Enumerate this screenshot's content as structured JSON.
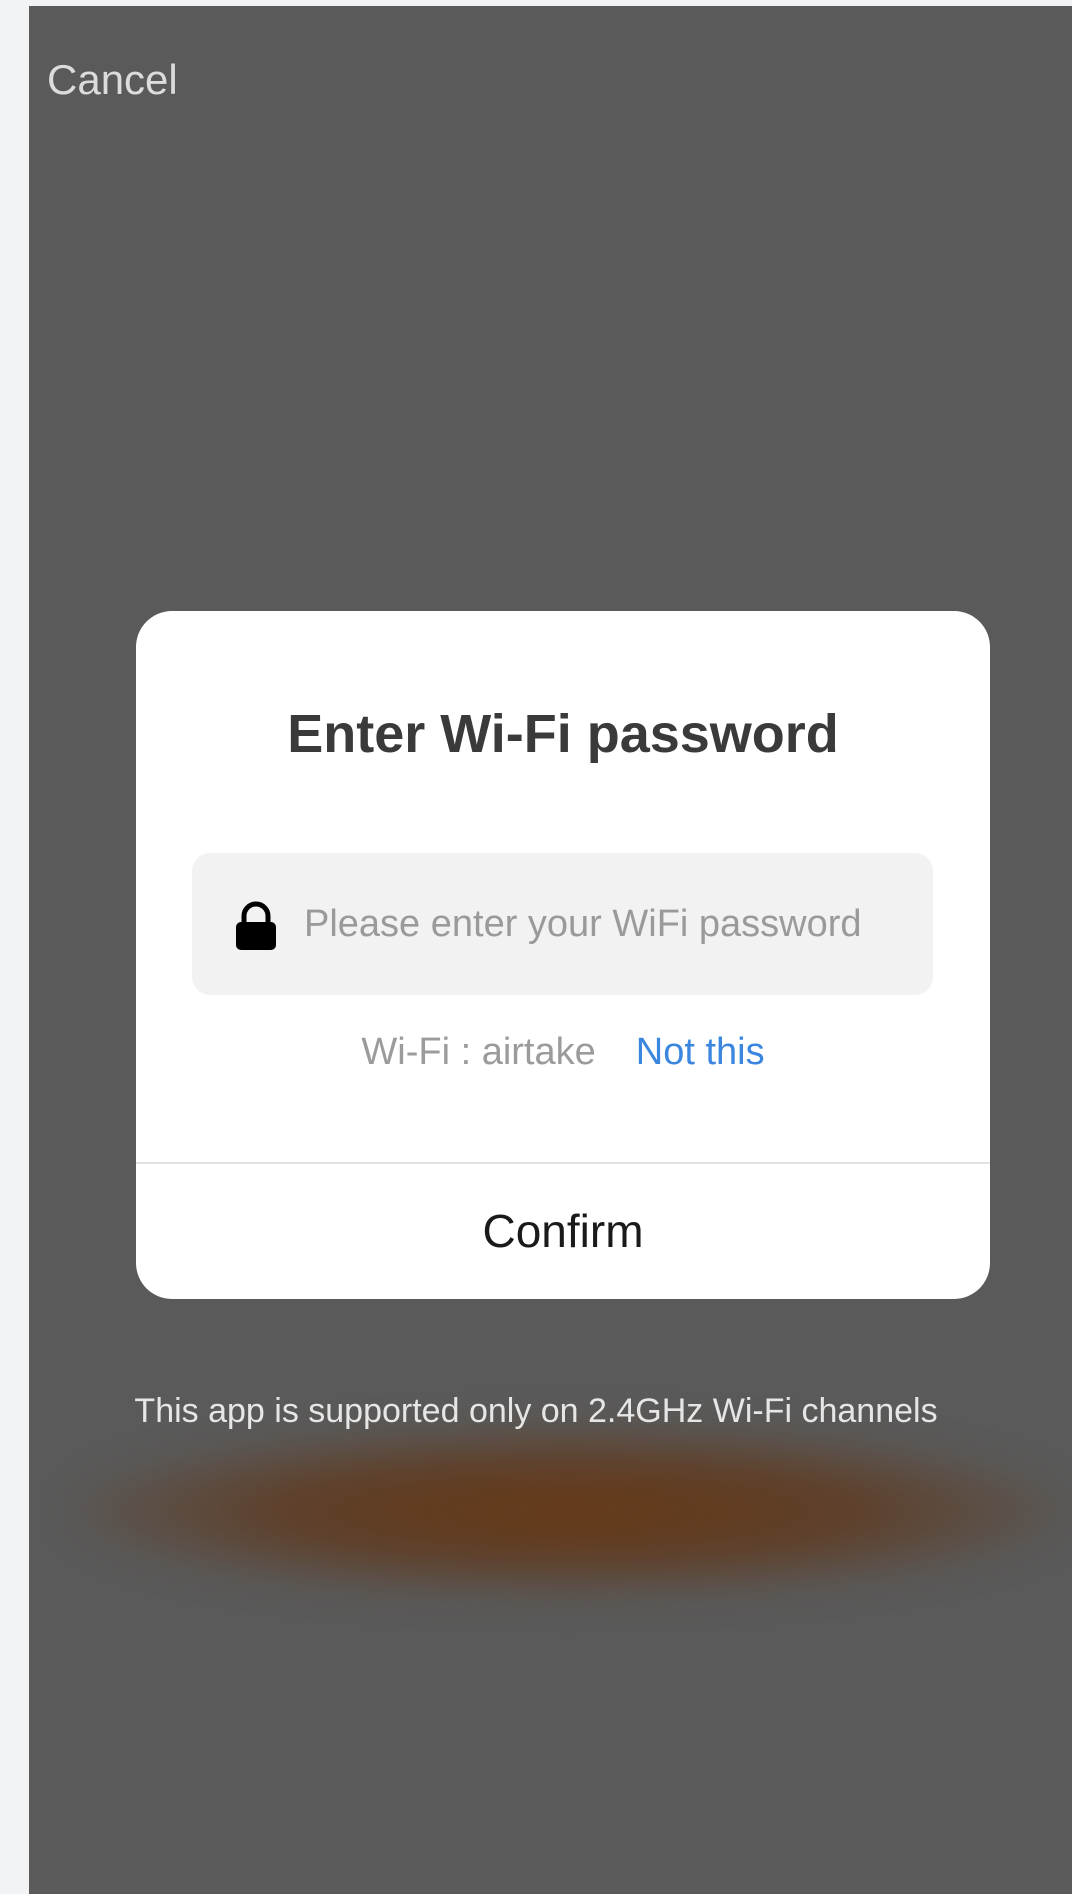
{
  "nav": {
    "cancel_label": "Cancel"
  },
  "dialog": {
    "title": "Enter Wi-Fi password",
    "password_placeholder": "Please enter your WiFi password",
    "password_value": "",
    "wifi_label": "Wi-Fi : airtake",
    "not_this_label": "Not this",
    "confirm_label": "Confirm",
    "icon": "lock-icon"
  },
  "footer": {
    "note": "This app is supported only on 2.4GHz Wi-Fi channels"
  },
  "colors": {
    "overlay": "#5a5a5a",
    "link": "#3b87df",
    "field_bg": "#f2f2f2",
    "glow": "#683814"
  }
}
